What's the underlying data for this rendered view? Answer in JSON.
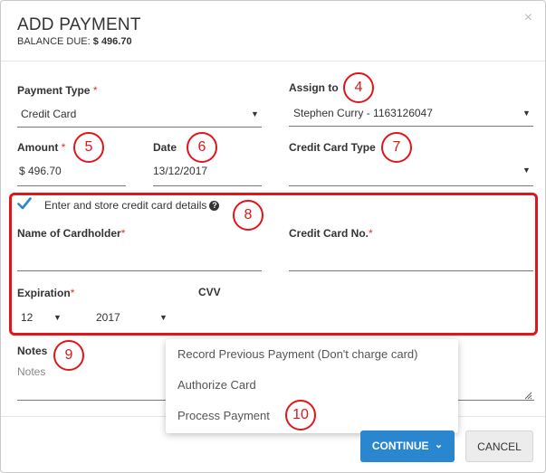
{
  "header": {
    "title": "ADD PAYMENT",
    "balance_label": "BALANCE DUE:",
    "balance_value": "$ 496.70",
    "close_symbol": "×"
  },
  "fields": {
    "payment_type": {
      "label": "Payment Type",
      "required": "*",
      "value": "Credit Card"
    },
    "assign_to": {
      "label": "Assign to",
      "value": "Stephen Curry - 1163126047"
    },
    "amount": {
      "label": "Amount",
      "required": "*",
      "value": "$ 496.70"
    },
    "date": {
      "label": "Date",
      "value": "13/12/2017"
    },
    "credit_card_type": {
      "label": "Credit Card Type",
      "value": ""
    },
    "store_card": {
      "label": "Enter and store credit card details",
      "checked": true,
      "help_icon": "?"
    },
    "cardholder": {
      "label": "Name of Cardholder",
      "required": "*",
      "value": ""
    },
    "card_no": {
      "label": "Credit Card No.",
      "required": "*",
      "value": ""
    },
    "expiration": {
      "label": "Expiration",
      "required": "*",
      "month": "12",
      "year": "2017"
    },
    "cvv": {
      "label": "CVV",
      "value": ""
    },
    "notes": {
      "label": "Notes",
      "placeholder": "Notes"
    }
  },
  "dropdown": {
    "items": [
      "Record Previous Payment (Don't charge card)",
      "Authorize Card",
      "Process Payment"
    ]
  },
  "buttons": {
    "continue": "CONTINUE",
    "continue_caret": "⌄",
    "cancel": "CANCEL"
  },
  "annotations": {
    "n4": "4",
    "n5": "5",
    "n6": "6",
    "n7": "7",
    "n8": "8",
    "n9": "9",
    "n10": "10"
  },
  "colors": {
    "accent_blue": "#2a86cf",
    "annotation_red": "#e0161a",
    "required_red": "#d9342b"
  },
  "icons": {
    "close": "close-icon",
    "check": "checkmark-icon",
    "help": "question-circle-icon",
    "caret": "caret-down-icon",
    "resize": "resize-handle-icon"
  }
}
